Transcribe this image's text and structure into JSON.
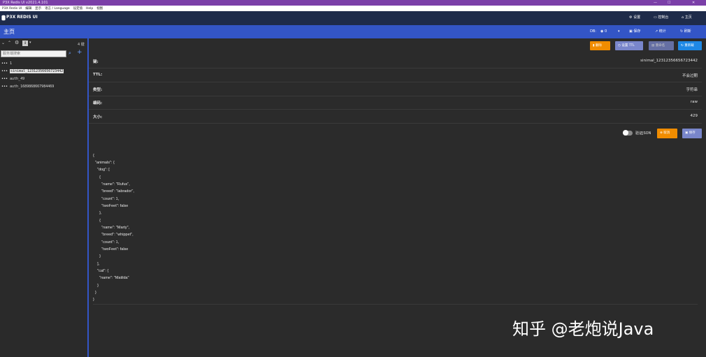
{
  "window": {
    "title": "P3X Redis UI v2021.4.101",
    "min": "—",
    "max": "☐",
    "close": "✕"
  },
  "menu": [
    "P3X Redis UI",
    "编辑",
    "显示",
    "语言 / Language",
    "设定值",
    "Help",
    "视图"
  ],
  "appbar": {
    "logo": "P3X REDIS UI",
    "settings": "设置",
    "console": "控制台",
    "home": "主页"
  },
  "header": {
    "title": "主页",
    "db_label": "DB:",
    "db_value": "0",
    "save": "保存",
    "stats": "统计",
    "refresh": "刷新"
  },
  "sidebar": {
    "key_count": "4 键",
    "search_placeholder": "服务端搜索",
    "sort_indicator": "↕",
    "keys": [
      {
        "name": "1"
      },
      {
        "name": "sinimal_12312356656723442",
        "selected": true
      },
      {
        "name": "auth_49"
      },
      {
        "name": "auth_1689868667984469"
      }
    ]
  },
  "actions": {
    "delete": "删除",
    "set_ttl": "设置 TTL",
    "rename": "重命名",
    "reload": "重新载"
  },
  "details": {
    "key_label": "键:",
    "key_value": "sinimal_12312356656723442",
    "ttl_label": "TTL:",
    "ttl_value": "不会过期",
    "type_label": "类型:",
    "type_value": "字符串",
    "encoding_label": "编码:",
    "encoding_value": "raw",
    "size_label": "大小:",
    "size_value": "429"
  },
  "editor": {
    "validate_json": "验证JSON",
    "cancel": "取消",
    "save": "保存",
    "lines": [
      "{",
      "  \"animals\": {",
      "    \"dog\": [",
      "      {",
      "        \"name\": \"Rufus\",",
      "        \"breed\": \"labrador\",",
      "        \"count\": 1,",
      "        \"twoFeet\": false",
      "      },",
      "      {",
      "        \"name\": \"Marty\",",
      "        \"breed\": \"whippet\",",
      "        \"count\": 1,",
      "        \"twoFeet\": false",
      "      }",
      "    ],",
      "    \"cat\": {",
      "      \"name\": \"Matilda\"",
      "    }",
      "  }",
      "}"
    ]
  },
  "watermark": "知乎 @老炮说Java",
  "colors": {
    "accent": "#3355c6",
    "delete": "#f08c00",
    "reload": "#1e88e5",
    "cancel": "#f08c00",
    "titlebar": "#7b3fa8"
  }
}
